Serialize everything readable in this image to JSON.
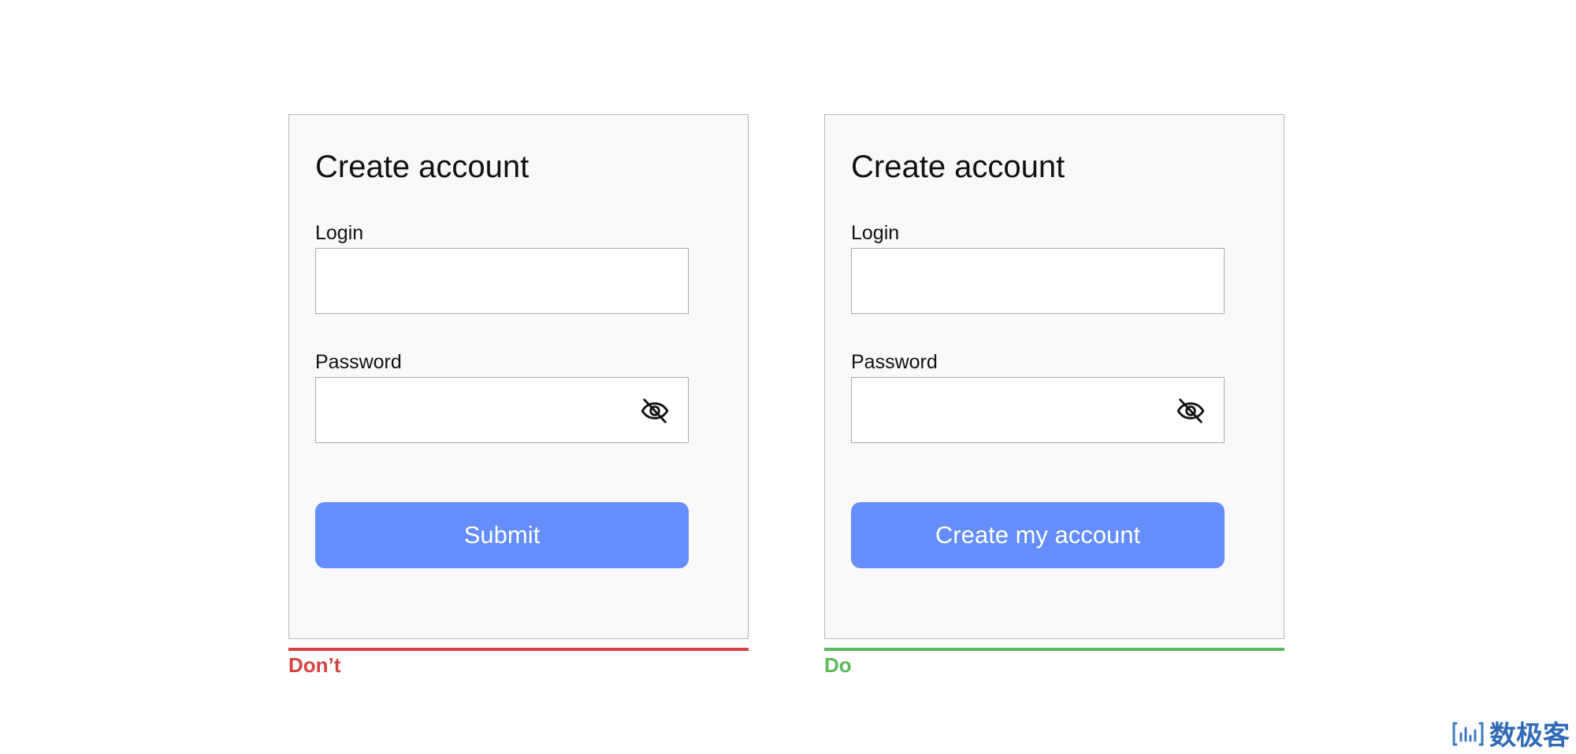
{
  "colors": {
    "card_background": "#f9f9f9",
    "card_border": "#b9b9b9",
    "input_border": "#a9a9a9",
    "primary_button": "#658dfb",
    "dont": "#d64242",
    "do": "#5ab95a",
    "watermark": "#2f6bb8"
  },
  "examples": [
    {
      "verdict": "Don’t",
      "verdict_color": "#d64242",
      "title": "Create account",
      "login_label": "Login",
      "login_value": "",
      "password_label": "Password",
      "password_value": "",
      "password_toggle_icon": "eye-slash-icon",
      "button_label": "Submit"
    },
    {
      "verdict": "Do",
      "verdict_color": "#5ab95a",
      "title": "Create account",
      "login_label": "Login",
      "login_value": "",
      "password_label": "Password",
      "password_value": "",
      "password_toggle_icon": "eye-slash-icon",
      "button_label": "Create my account"
    }
  ],
  "watermark": {
    "icon": "bar-chart-icon",
    "text": "数极客"
  }
}
